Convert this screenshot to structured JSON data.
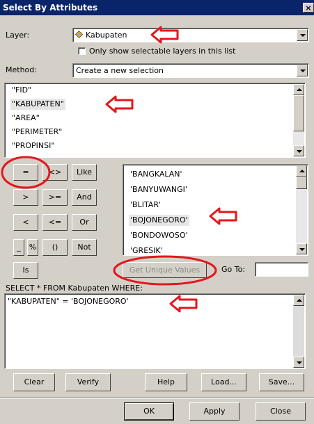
{
  "window": {
    "title": "Select By Attributes",
    "close_label": "×"
  },
  "layer": {
    "label": "Layer:",
    "value": "Kabupaten",
    "only_selectable_label": "Only show selectable layers in this list"
  },
  "method": {
    "label": "Method:",
    "value": "Create a new selection"
  },
  "fields": [
    {
      "label": "\"FID\"",
      "selected": false
    },
    {
      "label": "\"KABUPATEN\"",
      "selected": true
    },
    {
      "label": "\"AREA\"",
      "selected": false
    },
    {
      "label": "\"PERIMETER\"",
      "selected": false
    },
    {
      "label": "\"PROPINSI\"",
      "selected": false
    }
  ],
  "operators": {
    "eq": "=",
    "neq": "<>",
    "like": "Like",
    "gt": ">",
    "gte": ">=",
    "and": "And",
    "lt": "<",
    "lte": "<=",
    "or": "Or",
    "underscore": "_",
    "percent": "%",
    "parens": "()",
    "not": "Not",
    "is": "Is"
  },
  "values": [
    {
      "label": "'BANGKALAN'",
      "selected": false
    },
    {
      "label": "'BANYUWANGI'",
      "selected": false
    },
    {
      "label": "'BLITAR'",
      "selected": false
    },
    {
      "label": "'BOJONEGORO'",
      "selected": true
    },
    {
      "label": "'BONDOWOSO'",
      "selected": false
    },
    {
      "label": "'GRESIK'",
      "selected": false
    }
  ],
  "get_unique_values_label": "Get Unique Values",
  "go_to_label": "Go To:",
  "go_to_value": "",
  "where_clause_label": "SELECT * FROM Kabupaten WHERE:",
  "expression": "\"KABUPATEN\" = 'BOJONEGORO'",
  "bottom_buttons": {
    "clear": "Clear",
    "verify": "Verify",
    "help": "Help",
    "load": "Load...",
    "save": "Save..."
  },
  "dialog_buttons": {
    "ok": "OK",
    "apply": "Apply",
    "close": "Close"
  },
  "colors": {
    "annotation_red": "#e4161c",
    "title_bar": "#0a246a",
    "dialog_face": "#d4d0c8"
  }
}
